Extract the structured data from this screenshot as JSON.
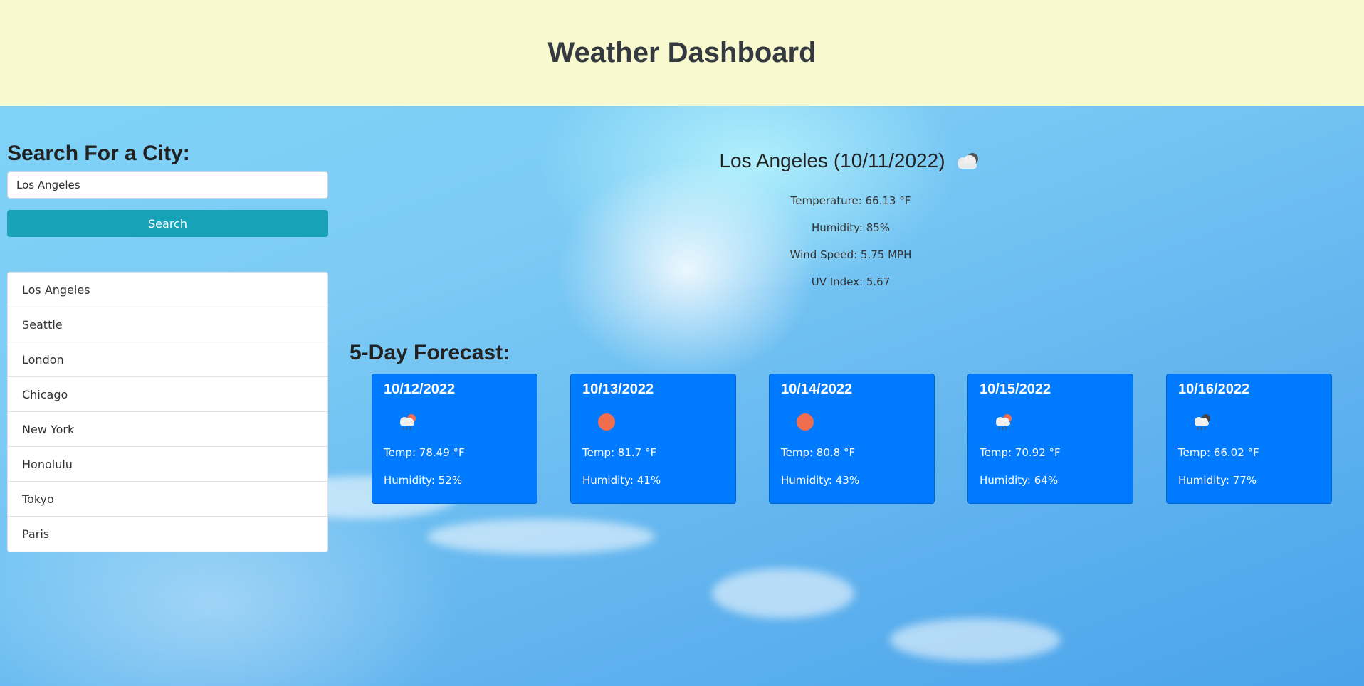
{
  "header": {
    "title": "Weather Dashboard"
  },
  "sidebar": {
    "heading": "Search For a City:",
    "search_value": "Los Angeles",
    "search_button": "Search",
    "history": [
      "Los Angeles",
      "Seattle",
      "London",
      "Chicago",
      "New York",
      "Honolulu",
      "Tokyo",
      "Paris"
    ]
  },
  "current": {
    "title": "Los Angeles (10/11/2022)",
    "icon": "cloud-icon",
    "temperature": "Temperature: 66.13 °F",
    "humidity": "Humidity: 85%",
    "wind": "Wind Speed: 5.75 MPH",
    "uv": "UV Index: 5.67"
  },
  "forecast": {
    "title": "5-Day Forecast:",
    "days": [
      {
        "date": "10/12/2022",
        "icon": "cloud-sun-rain-icon",
        "temp": "Temp: 78.49 °F",
        "humidity": "Humidity: 52%"
      },
      {
        "date": "10/13/2022",
        "icon": "sun-icon",
        "temp": "Temp: 81.7 °F",
        "humidity": "Humidity: 41%"
      },
      {
        "date": "10/14/2022",
        "icon": "sun-icon",
        "temp": "Temp: 80.8 °F",
        "humidity": "Humidity: 43%"
      },
      {
        "date": "10/15/2022",
        "icon": "cloud-sun-rain-icon",
        "temp": "Temp: 70.92 °F",
        "humidity": "Humidity: 64%"
      },
      {
        "date": "10/16/2022",
        "icon": "cloud-night-rain-icon",
        "temp": "Temp: 66.02 °F",
        "humidity": "Humidity: 77%"
      }
    ]
  },
  "colors": {
    "header_bg": "#f9f9cf",
    "button": "#17a2b8",
    "card": "#007bff",
    "sun": "#ee6e4f"
  }
}
